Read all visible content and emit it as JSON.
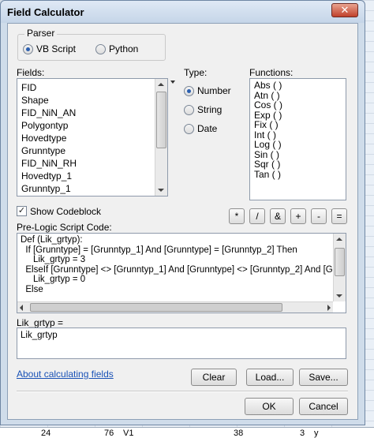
{
  "window": {
    "title": "Field Calculator",
    "close_label": "✕"
  },
  "parser": {
    "label": "Parser",
    "options": [
      {
        "label": "VB Script",
        "checked": true
      },
      {
        "label": "Python",
        "checked": false
      }
    ]
  },
  "fields": {
    "label": "Fields:",
    "items": [
      "FID",
      "Shape",
      "FID_NiN_AN",
      "Polygontyp",
      "Hovedtype",
      "Grunntype",
      "FID_NiN_RH",
      "Hovedtyp_1",
      "Grunntyp_1"
    ]
  },
  "type": {
    "label": "Type:",
    "options": [
      {
        "label": "Number",
        "checked": true
      },
      {
        "label": "String",
        "checked": false
      },
      {
        "label": "Date",
        "checked": false
      }
    ]
  },
  "functions": {
    "label": "Functions:",
    "items": [
      "Abs ( )",
      "Atn ( )",
      "Cos ( )",
      "Exp ( )",
      "Fix ( )",
      "Int ( )",
      "Log ( )",
      "Sin ( )",
      "Sqr ( )",
      "Tan ( )"
    ]
  },
  "show_codeblock": {
    "label": "Show Codeblock",
    "checked": true
  },
  "operators": [
    "*",
    "/",
    "&",
    "+",
    "-",
    "="
  ],
  "prelogic": {
    "label": "Pre-Logic Script Code:",
    "lines": [
      "Def (Lik_grtyp):",
      "  If [Grunntype] = [Grunntyp_1] And [Grunntype] = [Grunntyp_2] Then",
      "     Lik_grtyp = 3",
      "  ElseIf [Grunntype] <> [Grunntyp_1] And [Grunntype] <> [Grunntyp_2] And [Grunn",
      "     Lik_grtyp = 0",
      "  Else"
    ]
  },
  "expression": {
    "label": "Lik_grtyp =",
    "value": "Lik_grtyp"
  },
  "help_link": "About calculating fields",
  "buttons": {
    "clear": "Clear",
    "load": "Load...",
    "save": "Save...",
    "ok": "OK",
    "cancel": "Cancel"
  },
  "background_row": [
    "24",
    "76",
    "V1",
    "38",
    "3",
    "y"
  ]
}
